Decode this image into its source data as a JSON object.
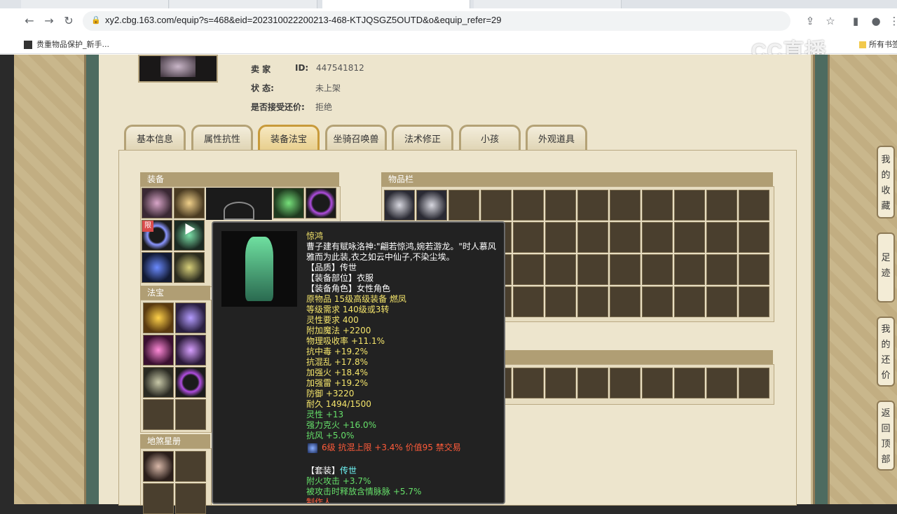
{
  "browser": {
    "url": "xy2.cbg.163.com/equip?s=468&eid=202310022200213-468-KTJQSGZ5OUTD&o&equip_refer=29",
    "bookmark_label": "贵重物品保护_新手...",
    "bookmark_right": "所有书签",
    "watermark": "CC直播"
  },
  "seller": {
    "label_seller": "卖   家",
    "label_id": "ID:",
    "id_value": "447541812",
    "label_status": "状          态:",
    "status_value": "未上架",
    "label_counter": "是否接受还价:",
    "counter_value": "拒绝"
  },
  "tabs": [
    {
      "label": "基本信息"
    },
    {
      "label": "属性抗性"
    },
    {
      "label": "装备法宝"
    },
    {
      "label": "坐骑召唤兽"
    },
    {
      "label": "法术修正"
    },
    {
      "label": "小孩"
    },
    {
      "label": "外观道具"
    }
  ],
  "sections": {
    "equipment": "装备",
    "inventory": "物品栏",
    "fabao": "法宝",
    "disha": "地煞星册"
  },
  "tooltip": {
    "name": "惊鸿",
    "desc": "曹子建有赋咏洛神:\"翩若惊鸿,婉若游龙。\"时人慕风雅而为此装,衣之如云中仙子,不染尘埃。",
    "quality": "【品质】传世",
    "slot": "【装备部位】衣服",
    "role": "【装备角色】女性角色",
    "origin": "原物品 15级高级装备 燃凤",
    "level_req": "等级需求 140级或3转",
    "spirit_req": "灵性要求 400",
    "stat1": "附加魔法 +2200",
    "stat2": "物理吸收率 +11.1%",
    "stat3": "抗中毒 +19.2%",
    "stat4": "抗混乱 +17.8%",
    "stat5": "加强火 +18.4%",
    "stat6": "加强雷 +19.2%",
    "stat7": "防御 +3220",
    "durability": "耐久 1494/1500",
    "green1": "灵性 +13",
    "green2": "强力克火 +16.0%",
    "green3": "抗风 +5.0%",
    "gem": "6级 抗混上限 +3.4% 价值95 禁交易",
    "set_label": "【套装】",
    "set_value": "传世",
    "set1": "附火攻击 +3.7%",
    "set2": "被攻击时释放含情脉脉 +5.7%",
    "maker": "制作人 "
  },
  "limit_badge": "限",
  "side_buttons": [
    {
      "label": [
        "我",
        "的",
        "收",
        "藏"
      ]
    },
    {
      "label": [
        "足",
        "迹"
      ]
    },
    {
      "label": [
        "我",
        "的",
        "还",
        "价"
      ]
    },
    {
      "label": [
        "返",
        "回",
        "顶",
        "部"
      ]
    }
  ],
  "colors": {
    "accent_gold": "#c89a3a",
    "frame_green": "#4d6b60",
    "panel_bg": "#ede5cd",
    "section_head": "#b09e74"
  }
}
